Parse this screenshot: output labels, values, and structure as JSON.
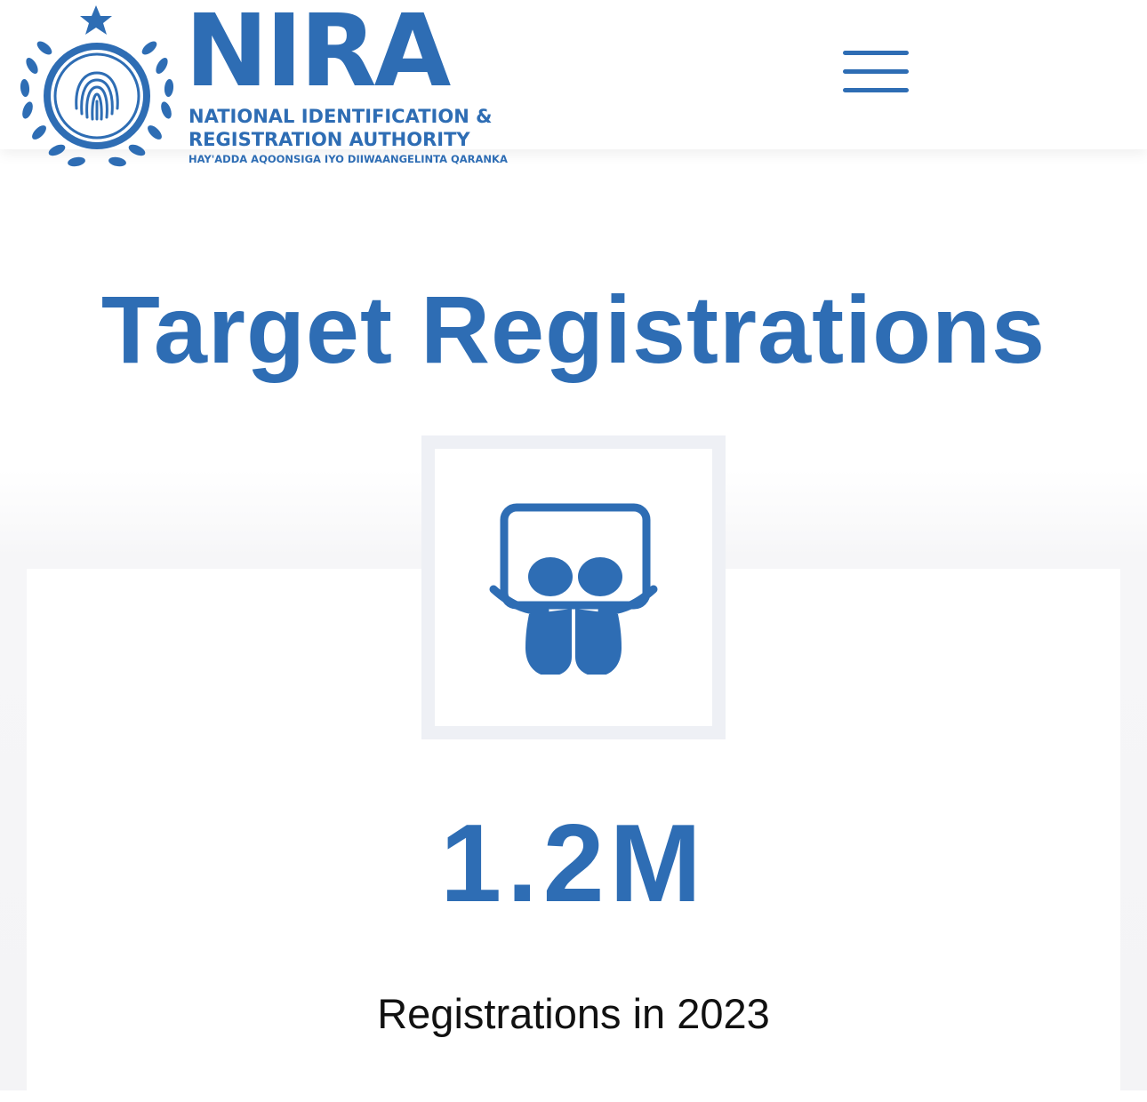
{
  "header": {
    "brand_name": "NIRA",
    "brand_line1": "NATIONAL IDENTIFICATION &",
    "brand_line2": "REGISTRATION AUTHORITY",
    "brand_line3": "HAY'ADDA AQOONSIGA IYO DIIWAANGELINTA QARANKA",
    "menu_icon": "hamburger-menu-icon"
  },
  "section": {
    "title": "Target Registrations",
    "stat": {
      "icon": "slideshare-icon",
      "value": "1.2M",
      "label": "Registrations in 2023"
    }
  },
  "colors": {
    "brand_blue": "#2e6db4",
    "icon_frame": "#eef0f5",
    "label_text": "#111111"
  }
}
